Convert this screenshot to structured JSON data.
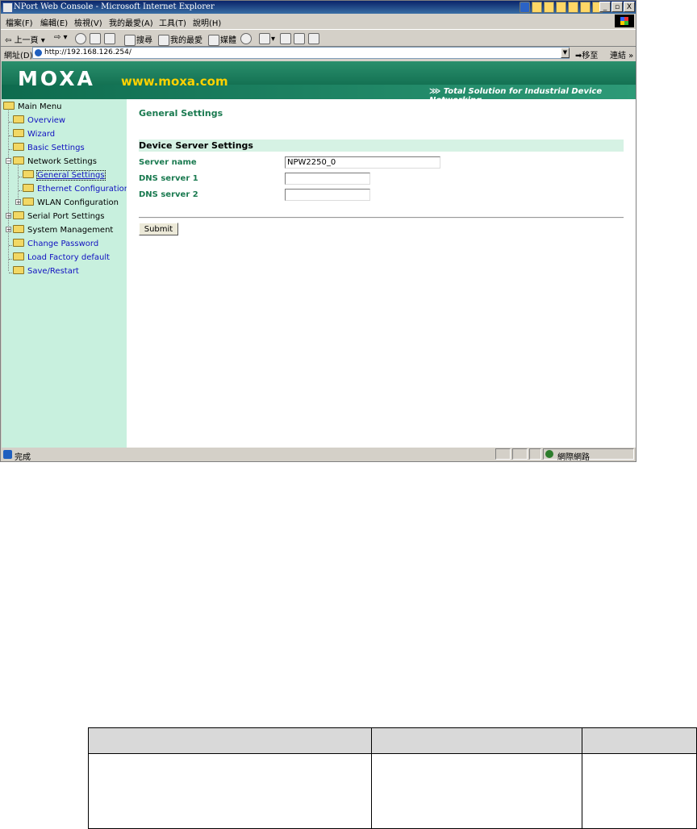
{
  "window": {
    "title": "NPort Web Console - Microsoft Internet Explorer",
    "controls": [
      "_",
      "▫",
      "X"
    ]
  },
  "menu": [
    "檔案(F)",
    "編輯(E)",
    "檢視(V)",
    "我的最愛(A)",
    "工具(T)",
    "說明(H)"
  ],
  "toolbar": {
    "back": "上一頁",
    "search": "搜尋",
    "favorites": "我的最愛",
    "media": "媒體"
  },
  "address": {
    "label": "網址(D)",
    "url": "http://192.168.126.254/",
    "go": "移至",
    "links": "連結"
  },
  "banner": {
    "logo": "MOXA",
    "url": "www.moxa.com",
    "tagline": "Total Solution for Industrial Device Networking"
  },
  "sidebar": {
    "items": [
      {
        "label": "Main Menu"
      },
      {
        "label": "Overview"
      },
      {
        "label": "Wizard"
      },
      {
        "label": "Basic Settings"
      },
      {
        "label": "Network Settings"
      },
      {
        "label": "General Settings"
      },
      {
        "label": "Ethernet Configuration"
      },
      {
        "label": "WLAN Configuration"
      },
      {
        "label": "Serial Port Settings"
      },
      {
        "label": "System Management"
      },
      {
        "label": "Change Password"
      },
      {
        "label": "Load Factory default"
      },
      {
        "label": "Save/Restart"
      }
    ]
  },
  "main": {
    "heading": "General Settings",
    "section": "Device Server Settings",
    "fields": [
      {
        "label": "Server name",
        "value": "NPW2250_0"
      },
      {
        "label": "DNS server 1",
        "value": ""
      },
      {
        "label": "DNS server 2",
        "value": ""
      }
    ],
    "submit": "Submit"
  },
  "status": {
    "text": "完成",
    "zone": "網際網路"
  }
}
